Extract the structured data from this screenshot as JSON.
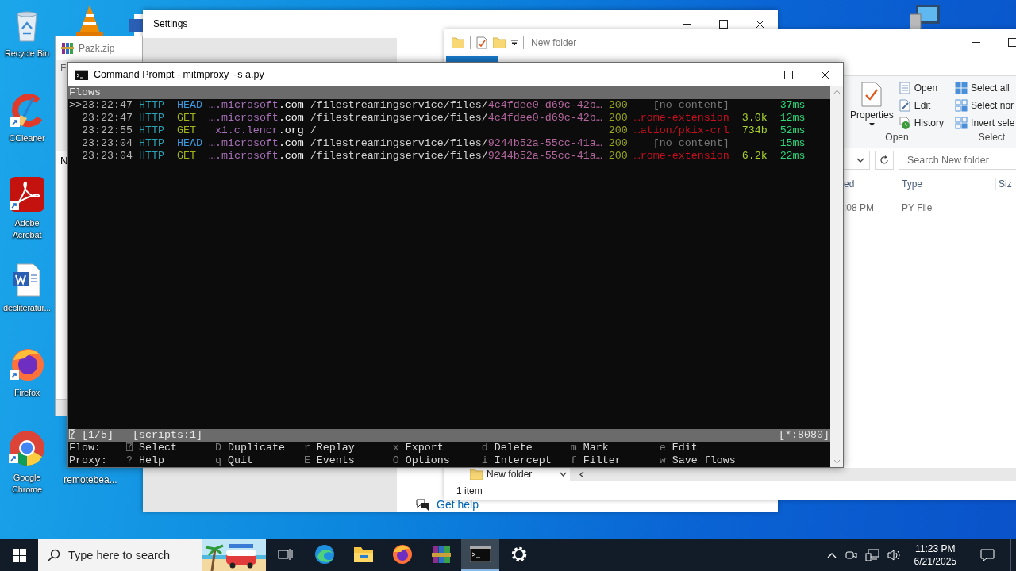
{
  "desktop": {
    "icons": [
      {
        "kind": "recycle",
        "label": "Recycle Bin"
      },
      {
        "kind": "cleaner",
        "label": "CCleaner"
      },
      {
        "kind": "pdf",
        "label": "Adobe Acrobat"
      },
      {
        "kind": "word",
        "label": "decliteratur..."
      },
      {
        "kind": "firefox",
        "label": "Firefox"
      },
      {
        "kind": "chrome",
        "label": "Google Chrome"
      }
    ],
    "covered_icon_label": "remotebea..."
  },
  "settings_window": {
    "title": "Settings",
    "help_link": "Get help"
  },
  "archive_window": {
    "title": "Pazk.zip",
    "menu_fragment": "Fi",
    "list_fragment": "N"
  },
  "explorer_window": {
    "title": "New folder",
    "ribbon": {
      "properties": "Properties",
      "open": "Open",
      "edit": "Edit",
      "history": "History",
      "open_group": "Open",
      "select_all": "Select all",
      "select_none": "Select nor",
      "invert": "Invert sele",
      "select_group": "Select"
    },
    "search": {
      "placeholder": "Search New folder"
    },
    "columns": [
      "ed",
      "Type",
      "Siz"
    ],
    "rows": [
      {
        "modified": ":08 PM",
        "type": "PY File"
      }
    ],
    "nav_item": "New folder",
    "status": "1 item"
  },
  "console_window": {
    "title": "Command Prompt - mitmproxy  -s a.py",
    "header": "Flows",
    "cursor": ">>",
    "flows": [
      {
        "selected": true,
        "time": "23:22:47",
        "scheme": "HTTP",
        "method": {
          "text": "HEAD",
          "color": "#3a96dd"
        },
        "host_name": "….microsoft",
        "host_tld": ".com",
        "path_dir": "/filestreamingservice/files/",
        "path_id": "4c4fdee0-d69c-42b…",
        "status": "200",
        "content": {
          "text": "[no content]",
          "color": "#767676"
        },
        "duration": "37ms"
      },
      {
        "selected": false,
        "time": "23:22:47",
        "scheme": "HTTP",
        "method": {
          "text": "GET",
          "color": "#a1b51a"
        },
        "host_name": "….microsoft",
        "host_tld": ".com",
        "path_dir": "/filestreamingservice/files/",
        "path_id": "4c4fdee0-d69c-42b…",
        "status": "200",
        "content": {
          "text": "…rome-extension",
          "color": "#c50f1f"
        },
        "size": "3.0k",
        "duration": "12ms"
      },
      {
        "selected": false,
        "time": "23:22:55",
        "scheme": "HTTP",
        "method": {
          "text": "GET",
          "color": "#a1b51a"
        },
        "host_name": "x1.c.lencr",
        "host_tld": ".org",
        "path_dir": "/",
        "status": "200",
        "content": {
          "text": "…ation/pkix-crl",
          "color": "#c50f1f"
        },
        "size": "734b",
        "duration": "52ms"
      },
      {
        "selected": false,
        "time": "23:23:04",
        "scheme": "HTTP",
        "method": {
          "text": "HEAD",
          "color": "#3a96dd"
        },
        "host_name": "….microsoft",
        "host_tld": ".com",
        "path_dir": "/filestreamingservice/files/",
        "path_id": "9244b52a-55cc-41a…",
        "status": "200",
        "content": {
          "text": "[no content]",
          "color": "#767676"
        },
        "duration": "15ms"
      },
      {
        "selected": false,
        "time": "23:23:04",
        "scheme": "HTTP",
        "method": {
          "text": "GET",
          "color": "#a1b51a"
        },
        "host_name": "….microsoft",
        "host_tld": ".com",
        "path_dir": "/filestreamingservice/files/",
        "path_id": "9244b52a-55cc-41a…",
        "status": "200",
        "content": {
          "text": "…rome-extension",
          "color": "#c50f1f"
        },
        "size": "6.2k",
        "duration": "22ms"
      }
    ],
    "status": {
      "position": "⍰ [1/5]",
      "scripts": "[scripts:1]",
      "listen": "[*:8080]"
    },
    "keys": [
      {
        "label": "Flow:",
        "items": [
          {
            "key": "⍰",
            "action": "Select"
          },
          {
            "key": "D",
            "action": "Duplicate"
          },
          {
            "key": "r",
            "action": "Replay"
          },
          {
            "key": "x",
            "action": "Export"
          },
          {
            "key": "d",
            "action": "Delete"
          },
          {
            "key": "m",
            "action": "Mark"
          },
          {
            "key": "e",
            "action": "Edit"
          }
        ]
      },
      {
        "label": "Proxy:",
        "items": [
          {
            "key": "?",
            "action": "Help"
          },
          {
            "key": "q",
            "action": "Quit"
          },
          {
            "key": "E",
            "action": "Events"
          },
          {
            "key": "O",
            "action": "Options"
          },
          {
            "key": "i",
            "action": "Intercept"
          },
          {
            "key": "f",
            "action": "Filter"
          },
          {
            "key": "w",
            "action": "Save flows"
          }
        ]
      }
    ]
  },
  "taskbar": {
    "search_placeholder": "Type here to search",
    "apps": [
      {
        "kind": "taskview",
        "selected": false
      },
      {
        "kind": "edge",
        "selected": false
      },
      {
        "kind": "explorer",
        "selected": false
      },
      {
        "kind": "firefox",
        "selected": false
      },
      {
        "kind": "winrar",
        "selected": false
      },
      {
        "kind": "cmd",
        "selected": true
      },
      {
        "kind": "settings",
        "selected": false
      }
    ],
    "time": "11:23 PM",
    "date": "6/21/2025"
  }
}
